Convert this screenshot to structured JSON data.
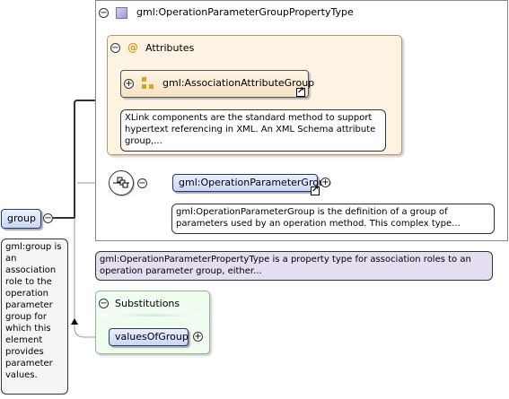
{
  "type_box": {
    "title": "gml:OperationParameterGroupPropertyType",
    "doc": "gml:OperationParameterPropertyType is a property type for association roles to an operation parameter group, either..."
  },
  "attributes": {
    "label": "Attributes",
    "at_symbol": "@",
    "group": {
      "name": "gml:AssociationAttributeGroup",
      "doc": "XLink components are the standard method to support hypertext referencing in XML. An XML Schema attribute group,..."
    }
  },
  "sequence": {
    "element": {
      "name": "gml:OperationParameterGroup",
      "doc": "gml:OperationParameterGroup is the definition of a group of parameters used by an operation method. This complex type..."
    }
  },
  "root": {
    "name": "group",
    "doc": "gml:group is an association role to the operation parameter group for which this element provides parameter values."
  },
  "substitutions": {
    "label": "Substitutions",
    "items": [
      {
        "name": "valuesOfGroup"
      }
    ]
  },
  "toggles": {
    "collapse": "−",
    "expand": "+"
  },
  "colors": {
    "attributes_bg": "#fdf3e3",
    "attributes_border": "#b89a6a",
    "substitutions_bg": "#effcef",
    "substitutions_border": "#8fb68f",
    "doc_note_bg": "#e4def0",
    "element_fill": "#c9d6f4"
  }
}
